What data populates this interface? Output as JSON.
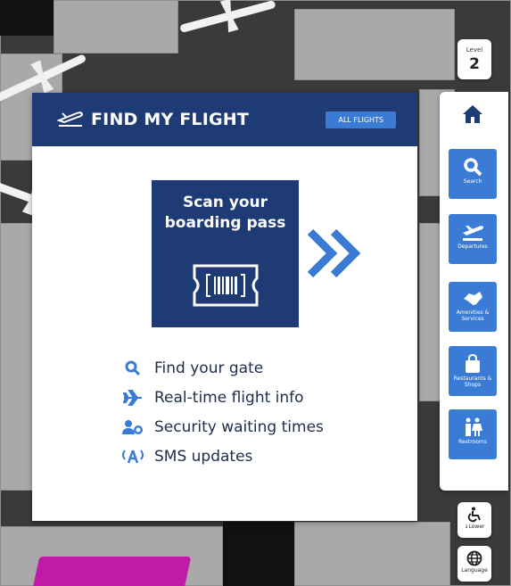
{
  "level": {
    "label": "Level",
    "number": "2"
  },
  "card": {
    "title": "FIND MY FLIGHT",
    "all_flights_label": "ALL FLIGHTS",
    "scan_line1": "Scan your",
    "scan_line2": "boarding pass",
    "features": [
      {
        "icon": "search-icon",
        "text": "Find your gate"
      },
      {
        "icon": "plane-icon",
        "text": "Real-time flight info"
      },
      {
        "icon": "user-clock-icon",
        "text": "Security waiting times"
      },
      {
        "icon": "broadcast-icon",
        "text": "SMS updates"
      }
    ]
  },
  "nav": {
    "items": [
      {
        "icon": "search-icon",
        "label": "Search"
      },
      {
        "icon": "departures-icon",
        "label": "Departures"
      },
      {
        "icon": "handshake-icon",
        "label": "Amenities & Services"
      },
      {
        "icon": "shopping-bag-icon",
        "label": "Restaurants & Shops"
      },
      {
        "icon": "restroom-icon",
        "label": "Restrooms"
      }
    ]
  },
  "lower": {
    "label": "Lower"
  },
  "language": {
    "label": "Language"
  },
  "colors": {
    "primary": "#1f3b75",
    "accent": "#3a7bd5",
    "brand_background": "#ffffff"
  }
}
